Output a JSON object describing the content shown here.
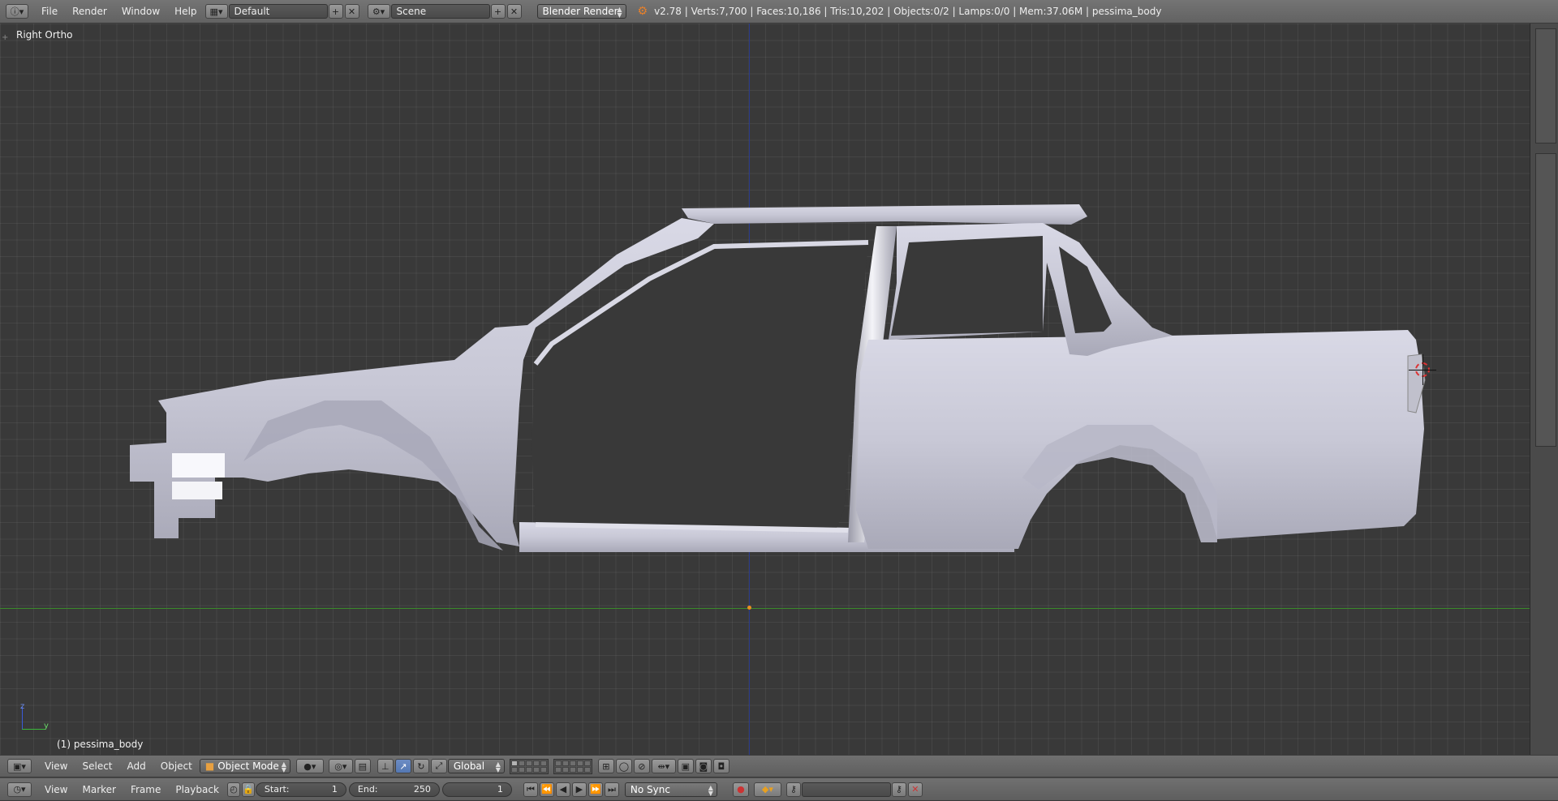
{
  "app": {
    "name": "Blender",
    "version": "v2.78"
  },
  "top_menu": {
    "items": [
      "File",
      "Render",
      "Window",
      "Help"
    ],
    "screen_layout": "Default",
    "scene": "Scene",
    "render_engine": "Blender Render",
    "stats": "v2.78 | Verts:7,700 | Faces:10,186 | Tris:10,202 | Objects:0/2 | Lamps:0/0 | Mem:37.06M | pessima_body"
  },
  "viewport": {
    "view_name": "Right Ortho",
    "object_label": "(1) pessima_body",
    "axis_z": "z",
    "axis_y": "y"
  },
  "view3d_header": {
    "menus": [
      "View",
      "Select",
      "Add",
      "Object"
    ],
    "mode": "Object Mode",
    "orientation": "Global"
  },
  "timeline": {
    "menus": [
      "View",
      "Marker",
      "Frame",
      "Playback"
    ],
    "start_label": "Start:",
    "start_value": "1",
    "end_label": "End:",
    "end_value": "250",
    "current_frame": "1",
    "sync": "No Sync"
  },
  "colors": {
    "accent_blue": "#5478b4",
    "x_axis_line": "#3a8a2a",
    "z_axis_line": "#2a3a8a",
    "origin": "#e89020"
  }
}
